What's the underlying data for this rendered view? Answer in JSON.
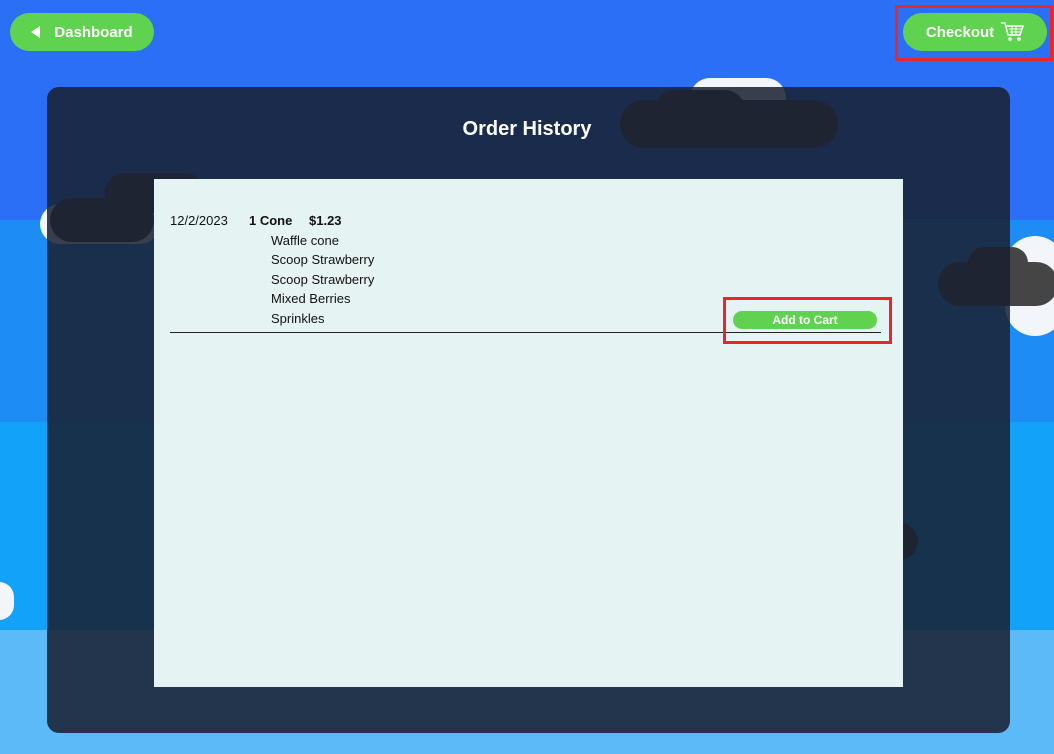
{
  "header": {
    "dashboard_label": "Dashboard",
    "checkout_label": "Checkout",
    "back_icon": "triangle-left-icon",
    "cart_icon": "shopping-cart-icon"
  },
  "page": {
    "title": "Order History"
  },
  "orders": [
    {
      "date": "12/2/2023",
      "count": "1 Cone",
      "price": "$1.23",
      "items": [
        "Waffle cone",
        "Scoop Strawberry",
        "Scoop Strawberry",
        "Mixed Berries",
        "Sprinkles"
      ],
      "add_label": "Add to Cart"
    }
  ],
  "colors": {
    "button_green": "#5fd350",
    "highlight_red": "#e8262b",
    "sky_blue": "#2a6ff5",
    "panel_bg": "#e5f3f3"
  }
}
